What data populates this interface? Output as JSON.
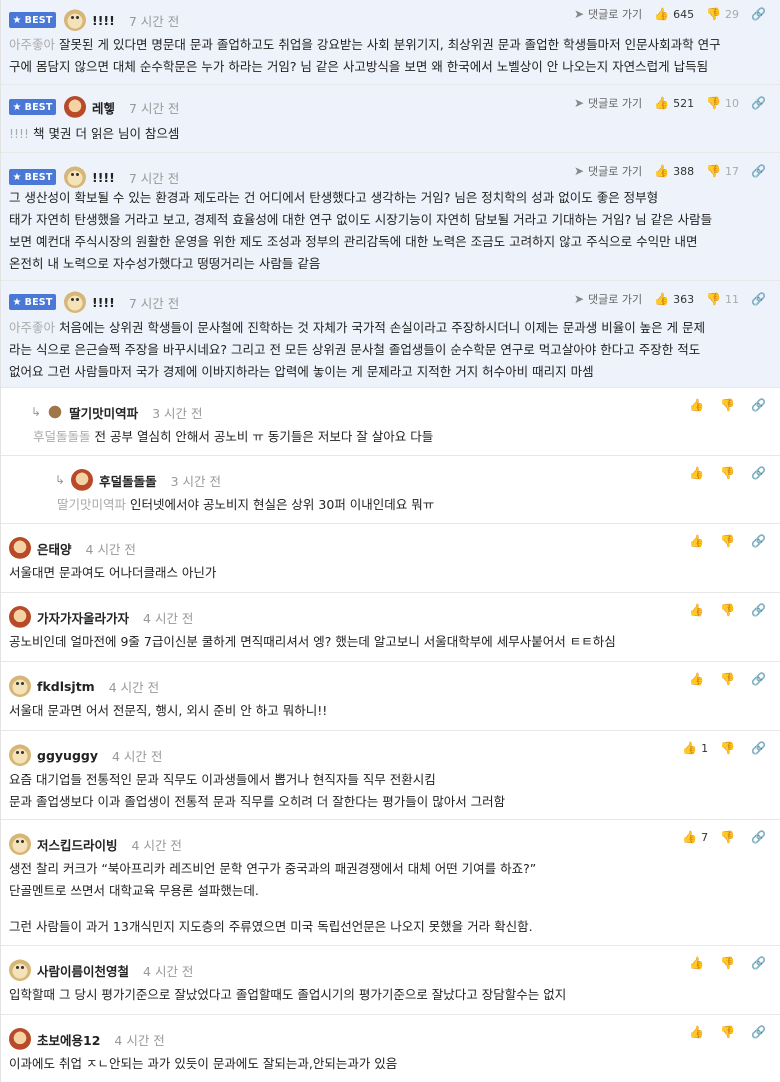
{
  "best_label": "BEST",
  "goto_label": "댓글로 가기",
  "best_comments": [
    {
      "nick": "!!!!",
      "time": "7 시간 전",
      "up": "645",
      "down": "29",
      "mention": "아주좋아",
      "lines": [
        "잘못된 게 있다면 명문대 문과 졸업하고도 취업을 강요받는 사회 분위기지, 최상위권 문과 졸업한 학생들마저 인문사회과학 연구",
        "구에 몸담지 않으면 대체 순수학문은 누가 하라는 거임? 님 같은 사고방식을 보면 왜 한국에서 노벨상이 안 나오는지 자연스럽게 납득됨"
      ]
    },
    {
      "nick": "레헿",
      "time": "7 시간 전",
      "up": "521",
      "down": "10",
      "mention": "!!!!",
      "lines": [
        "책 몇권 더 읽은 님이 참으셈"
      ]
    },
    {
      "nick": "!!!!",
      "time": "7 시간 전",
      "up": "388",
      "down": "17",
      "mention": "",
      "lines": [
        "그 생산성이 확보될 수 있는 환경과 제도라는 건 어디에서 탄생했다고 생각하는 거임? 님은 정치학의 성과 없이도 좋은 정부형",
        "태가 자연히 탄생했을 거라고 보고, 경제적 효율성에 대한 연구 없이도 시장기능이 자연히 담보될 거라고 기대하는 거임? 님 같은 사람들",
        "보면 예컨대 주식시장의 원활한 운영을 위한 제도 조성과 정부의 관리감독에 대한 노력은 조금도 고려하지 않고 주식으로 수익만 내면",
        "온전히 내 노력으로 자수성가했다고 떵떵거리는 사람들 같음"
      ]
    },
    {
      "nick": "!!!!",
      "time": "7 시간 전",
      "up": "363",
      "down": "11",
      "mention": "아주좋아",
      "lines": [
        "처음에는 상위권 학생들이 문사철에 진학하는 것 자체가 국가적 손실이라고 주장하시더니 이제는 문과생 비율이 높은 게 문제",
        "라는 식으로 은근슬쩍 주장을 바꾸시네요? 그리고 전 모든 상위권 문사철 졸업생들이 순수학문 연구로 먹고살아야 한다고 주장한 적도",
        "없어요 그런 사람들마저 국가 경제에 이바지하라는 압력에 놓이는 게 문제라고 지적한 거지 허수아비 때리지 마셈"
      ]
    }
  ],
  "replies": [
    {
      "nick": "딸기맛미역파",
      "time": "3 시간 전",
      "mention": "후덜돌돌돌",
      "text": "전 공부 열심히 안해서 공노비 ㅠ 동기들은 저보다 잘 살아요 다들"
    },
    {
      "nick": "후덜돌돌돌",
      "time": "3 시간 전",
      "mention": "딸기맛미역파",
      "text": "인터넷에서야 공노비지 현실은 상위 30퍼 이내인데요 뭐ㅠ"
    }
  ],
  "comments": [
    {
      "nick": "은태양",
      "time": "4 시간 전",
      "up": "",
      "lines": [
        "서울대면 문과여도 어나더클래스 아닌가"
      ]
    },
    {
      "nick": "가자가자올라가자",
      "time": "4 시간 전",
      "up": "",
      "lines": [
        "공노비인데 얼마전에 9줄 7급이신분 쿨하게 면직때리셔서 엥? 했는데 알고보니 서울대학부에 세무사붙어서 ㅌㅌ하심"
      ]
    },
    {
      "nick": "fkdlsjtm",
      "time": "4 시간 전",
      "up": "",
      "lines": [
        "서울대 문과면 어서 전문직, 행시, 외시 준비 안 하고 뭐하니!!"
      ]
    },
    {
      "nick": "ggyuggy",
      "time": "4 시간 전",
      "up": "1",
      "lines": [
        "요즘 대기업들 전통적인 문과 직무도 이과생들에서 뽑거나 현직자들 직무 전환시킴",
        "문과 졸업생보다 이과 졸업생이 전통적 문과 직무를 오히려 더 잘한다는 평가들이 많아서 그러함"
      ]
    },
    {
      "nick": "저스킵드라이빙",
      "time": "4 시간 전",
      "up": "7",
      "lines": [
        "생전 찰리 커크가 “북아프리카 레즈비언 문학 연구가 중국과의 패권경쟁에서 대체 어떤 기여를 하죠?”",
        "단골멘트로 쓰면서 대학교육 무용론 설파했는데.",
        "",
        "그런 사람들이 과거 13개식민지 지도층의 주류였으면 미국 독립선언문은 나오지 못했을 거라 확신함."
      ]
    },
    {
      "nick": "사람이름이천영철",
      "time": "4 시간 전",
      "up": "",
      "lines": [
        "입학할때 그 당시 평가기준으로 잘났었다고 졸업할때도 졸업시기의 평가기준으로 잘났다고 장담할수는 없지"
      ]
    },
    {
      "nick": "초보에용12",
      "time": "4 시간 전",
      "up": "",
      "lines": [
        "이과에도 취업 ㅈㄴ안되는 과가 있듯이 문과에도 잘되는과,안되는과가 있음"
      ]
    }
  ]
}
